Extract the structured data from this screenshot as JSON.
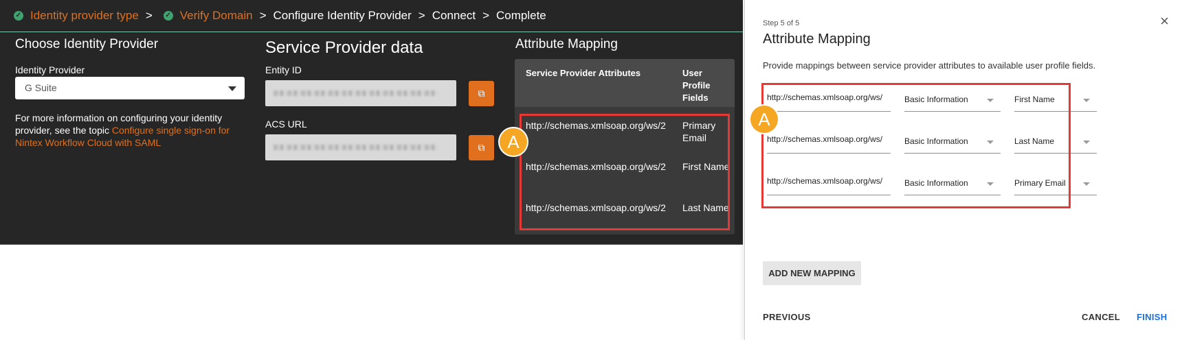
{
  "breadcrumb": [
    {
      "label": "Identity provider type",
      "done": true
    },
    {
      "label": "Verify Domain",
      "done": true
    },
    {
      "label": "Configure Identity Provider",
      "done": false
    },
    {
      "label": "Connect",
      "done": false
    },
    {
      "label": "Complete",
      "done": false
    }
  ],
  "breadcrumb_sep": ">",
  "left": {
    "choose_title": "Choose Identity Provider",
    "idp_label": "Identity Provider",
    "idp_value": "G Suite",
    "info_text": "For more information on configuring your identity provider, see the topic ",
    "info_link": "Configure single sign-on for Nintex Workflow Cloud with SAML"
  },
  "sp": {
    "title": "Service Provider data",
    "entity_label": "Entity ID",
    "acs_label": "ACS URL"
  },
  "attr": {
    "title": "Attribute Mapping",
    "col1": "Service Provider Attributes",
    "col2": "User Profile Fields",
    "rows": [
      {
        "attr": "http://schemas.xmlsoap.org/ws/2",
        "field": "Primary Email"
      },
      {
        "attr": "http://schemas.xmlsoap.org/ws/2",
        "field": "First Name"
      },
      {
        "attr": "http://schemas.xmlsoap.org/ws/2",
        "field": "Last Name"
      }
    ]
  },
  "badge_label": "A",
  "modal": {
    "step": "Step 5 of 5",
    "title": "Attribute Mapping",
    "close": "×",
    "description": "Provide mappings between service provider attributes to available user profile fields.",
    "mappings": [
      {
        "attr": "http://schemas.xmlsoap.org/ws/",
        "category": "Basic Information",
        "field": "First Name"
      },
      {
        "attr": "http://schemas.xmlsoap.org/ws/",
        "category": "Basic Information",
        "field": "Last Name"
      },
      {
        "attr": "http://schemas.xmlsoap.org/ws/",
        "category": "Basic Information",
        "field": "Primary Email"
      }
    ],
    "add_mapping": "ADD NEW MAPPING",
    "previous": "PREVIOUS",
    "cancel": "CANCEL",
    "finish": "FINISH"
  },
  "colors": {
    "accent_orange": "#e0701d",
    "highlight_red": "#e53935",
    "badge_yellow": "#f5a623",
    "finish_blue": "#1e6fd9",
    "check_green": "#3ea36e"
  },
  "icons": {
    "check": "check-circle-icon",
    "copy": "copy-icon",
    "close": "close-icon",
    "dropdown": "caret-down-icon"
  }
}
